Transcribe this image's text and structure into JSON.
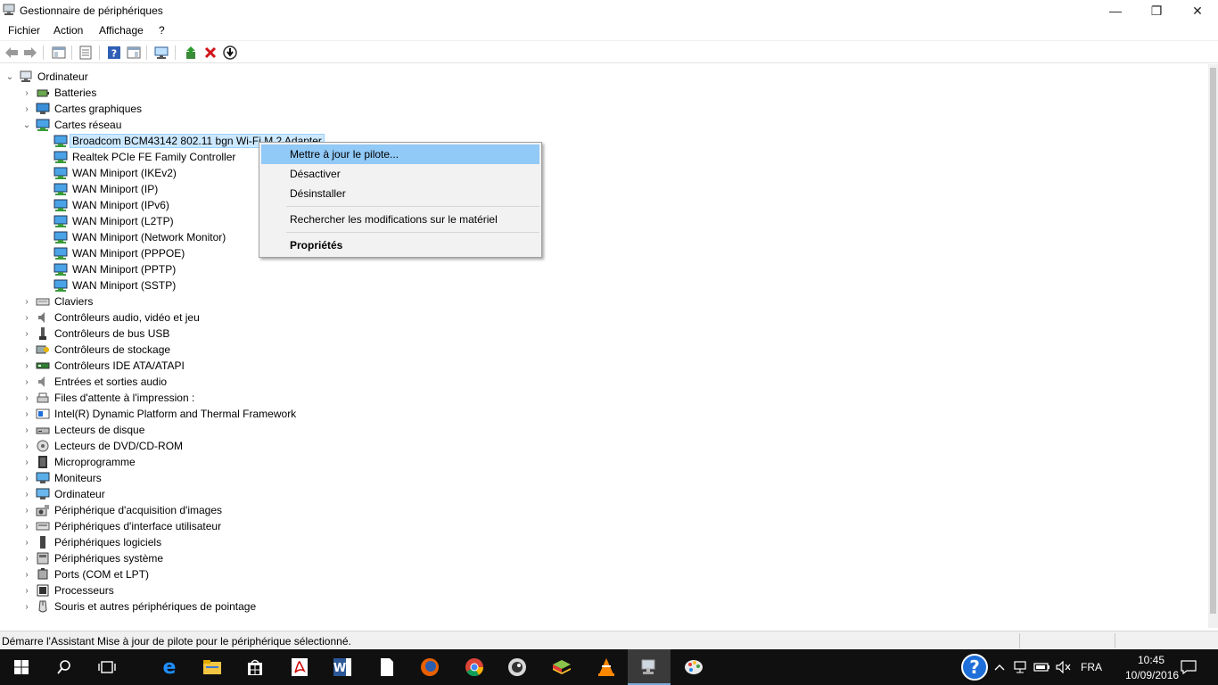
{
  "window": {
    "title": "Gestionnaire de périphériques",
    "minimize": "—",
    "maximize": "❐",
    "close": "✕"
  },
  "menubar": [
    "Fichier",
    "Action",
    "Affichage",
    "?"
  ],
  "tree": {
    "root": "Ordinateur",
    "categories_before": [
      "Batteries",
      "Cartes graphiques"
    ],
    "expanded_category": "Cartes réseau",
    "network_adapters": [
      "Broadcom BCM43142 802.11 bgn Wi-Fi M.2 Adapter",
      "Realtek PCIe FE Family Controller",
      "WAN Miniport (IKEv2)",
      "WAN Miniport (IP)",
      "WAN Miniport (IPv6)",
      "WAN Miniport (L2TP)",
      "WAN Miniport (Network Monitor)",
      "WAN Miniport (PPPOE)",
      "WAN Miniport (PPTP)",
      "WAN Miniport (SSTP)"
    ],
    "categories_after": [
      "Claviers",
      "Contrôleurs audio, vidéo et jeu",
      "Contrôleurs de bus USB",
      "Contrôleurs de stockage",
      "Contrôleurs IDE ATA/ATAPI",
      "Entrées et sorties audio",
      "Files d'attente à l'impression :",
      "Intel(R) Dynamic Platform and Thermal Framework",
      "Lecteurs de disque",
      "Lecteurs de DVD/CD-ROM",
      "Microprogramme",
      "Moniteurs",
      "Ordinateur",
      "Périphérique d'acquisition d'images",
      "Périphériques d'interface utilisateur",
      "Périphériques logiciels",
      "Périphériques système",
      "Ports (COM et LPT)",
      "Processeurs",
      "Souris et autres périphériques de pointage"
    ]
  },
  "context_menu": {
    "update_driver": "Mettre à jour le pilote...",
    "disable": "Désactiver",
    "uninstall": "Désinstaller",
    "scan": "Rechercher les modifications sur le matériel",
    "properties": "Propriétés"
  },
  "status": {
    "text": "Démarre l'Assistant Mise à jour de pilote pour le périphérique sélectionné."
  },
  "taskbar": {
    "language": "FRA",
    "time": "10:45",
    "date": "10/09/2016",
    "accent": "#7aa7d6"
  },
  "colors": {
    "selection": "#cce8ff",
    "menu_highlight": "#91c9f7",
    "delete_red": "#d0141a"
  }
}
